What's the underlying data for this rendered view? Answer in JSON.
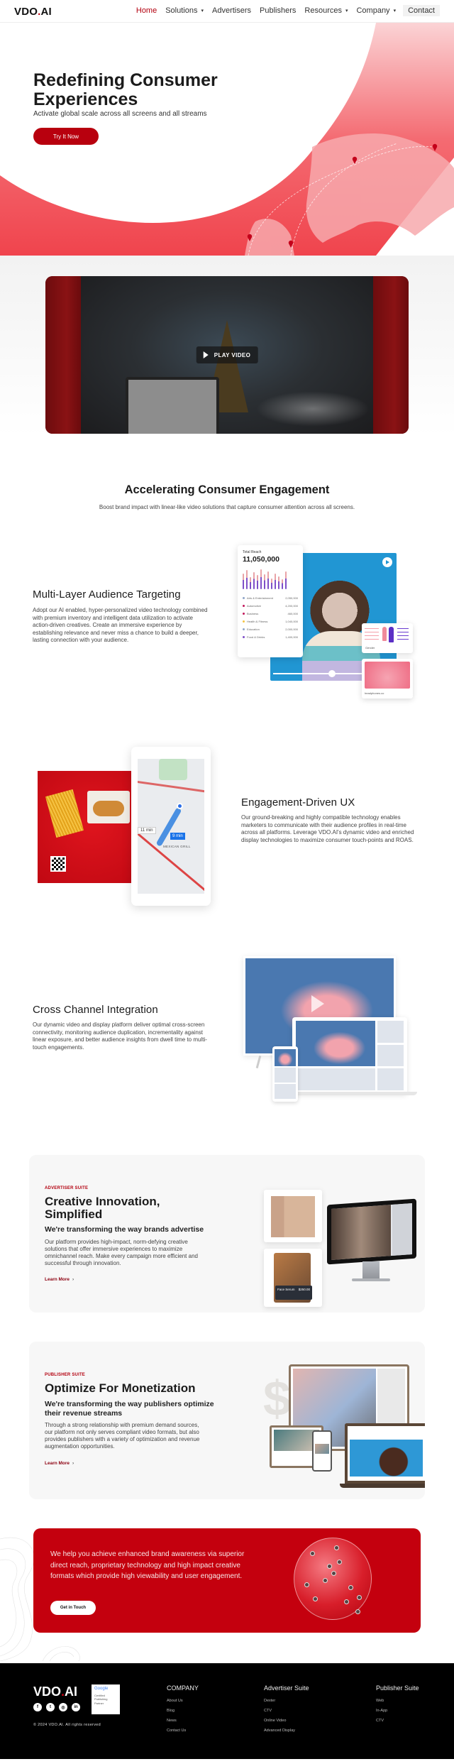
{
  "nav": {
    "logo_main": "VDO",
    "logo_dot": ".",
    "logo_suffix": "AI",
    "items": [
      {
        "label": "Home",
        "active": true,
        "dropdown": false
      },
      {
        "label": "Solutions",
        "dropdown": true
      },
      {
        "label": "Advertisers",
        "dropdown": false
      },
      {
        "label": "Publishers",
        "dropdown": false
      },
      {
        "label": "Resources",
        "dropdown": true
      },
      {
        "label": "Company",
        "dropdown": true
      },
      {
        "label": "Contact",
        "dropdown": false
      }
    ],
    "caret_glyph": "▾"
  },
  "hero": {
    "title": "Redefining Consumer Experiences",
    "subtitle": "Activate global scale across all screens and all streams",
    "cta_label": "Try It Now"
  },
  "video": {
    "play_label": "PLAY VIDEO"
  },
  "engagement": {
    "title": "Accelerating Consumer Engagement",
    "subtitle": "Boost brand impact with linear-like video solutions that capture consumer attention across all screens."
  },
  "features": [
    {
      "title": "Multi-Layer Audience Targeting",
      "text": "Adopt our AI enabled, hyper-personalized video technology combined with premium inventory and intelligent data utilization to activate action-driven creatives. Create an immersive experience by establishing relevance and never miss a chance to build a deeper, lasting connection with your audience."
    },
    {
      "title": "Engagement-Driven UX",
      "text": "Our ground-breaking and highly compatible technology enables marketers to communicate with their audience profiles in real-time across all platforms. Leverage VDO.AI's dynamic video and enriched display technologies to maximize consumer touch-points and ROAS."
    },
    {
      "title": "Cross Channel Integration",
      "text": "Our dynamic video and display platform deliver optimal cross-screen connectivity, monitoring audience duplication, incrementality against linear exposure, and better audience insights from dwell time to multi-touch engagements."
    }
  ],
  "reach_card": {
    "label": "Total Reach",
    "value": "11,050,000",
    "categories": [
      {
        "name": "Arts & Entertainment",
        "value": "2,050,000",
        "color": "#8fa6c8"
      },
      {
        "name": "Automotive",
        "value": "4,200,000",
        "color": "#c2185b"
      },
      {
        "name": "Business",
        "value": "460,000",
        "color": "#c2185b"
      },
      {
        "name": "Health & Fitness",
        "value": "1,040,000",
        "color": "#f5c542"
      },
      {
        "name": "Education",
        "value": "2,000,000",
        "color": "#8fa6c8"
      },
      {
        "name": "Food & Drinks",
        "value": "1,400,000",
        "color": "#7e4fc8"
      }
    ],
    "gender_label": "Gender",
    "headphones_label": "headphones.co"
  },
  "map_card": {
    "time_alt": "11 min",
    "time_main": "9 min",
    "place": "MEXICAN GRILL"
  },
  "advertiser_suite": {
    "kicker": "ADVERTISER SUITE",
    "title": "Creative Innovation, Simplified",
    "subtitle": "We're transforming the way brands advertise",
    "text": "Our platform provides high-impact, norm-defying creative solutions that offer immersive experiences to maximize omnichannel reach. Make every campaign more efficient and successful through innovation.",
    "link_label": "Learn More",
    "product_name": "Face Serum",
    "product_price": "$250.00"
  },
  "publisher_suite": {
    "kicker": "PUBLISHER SUITE",
    "title": "Optimize For Monetization",
    "subtitle": "We're transforming the way publishers optimize their revenue streams",
    "text": "Through a strong relationship with premium demand sources, our platform not only serves compliant video formats, but also provides publishers with a variety of optimization and revenue augmentation opportunities.",
    "link_label": "Learn More"
  },
  "cta": {
    "text": "We help you achieve enhanced brand awareness via superior direct reach, proprietary technology and high impact creative formats which provide high viewability and user engagement.",
    "button_label": "Get in Touch"
  },
  "footer": {
    "logo_main": "VDO",
    "logo_dot": ".",
    "logo_suffix": "AI",
    "social": [
      {
        "icon": "facebook-icon",
        "glyph": "f"
      },
      {
        "icon": "twitter-icon",
        "glyph": "t"
      },
      {
        "icon": "instagram-icon",
        "glyph": "◎"
      },
      {
        "icon": "linkedin-icon",
        "glyph": "in"
      }
    ],
    "badge": {
      "brand": "Google",
      "line1": "Certified",
      "line2": "Publishing",
      "line3": "Partner"
    },
    "copyright": "© 2024 VDO.AI. All rights reserved",
    "columns": [
      {
        "title": "COMPANY",
        "links": [
          "About Us",
          "Blog",
          "News",
          "Contact Us"
        ]
      },
      {
        "title": "Advertiser Suite",
        "links": [
          "Dexter",
          "CTV",
          "Online Video",
          "Advanced Display"
        ]
      },
      {
        "title": "Publisher Suite",
        "links": [
          "Web",
          "In-App",
          "CTV"
        ]
      }
    ]
  },
  "colors": {
    "brand_red": "#c4000e",
    "accent_dark_red": "#b3000f",
    "text_dark": "#1b1b1b",
    "footer_bg": "#000000"
  }
}
